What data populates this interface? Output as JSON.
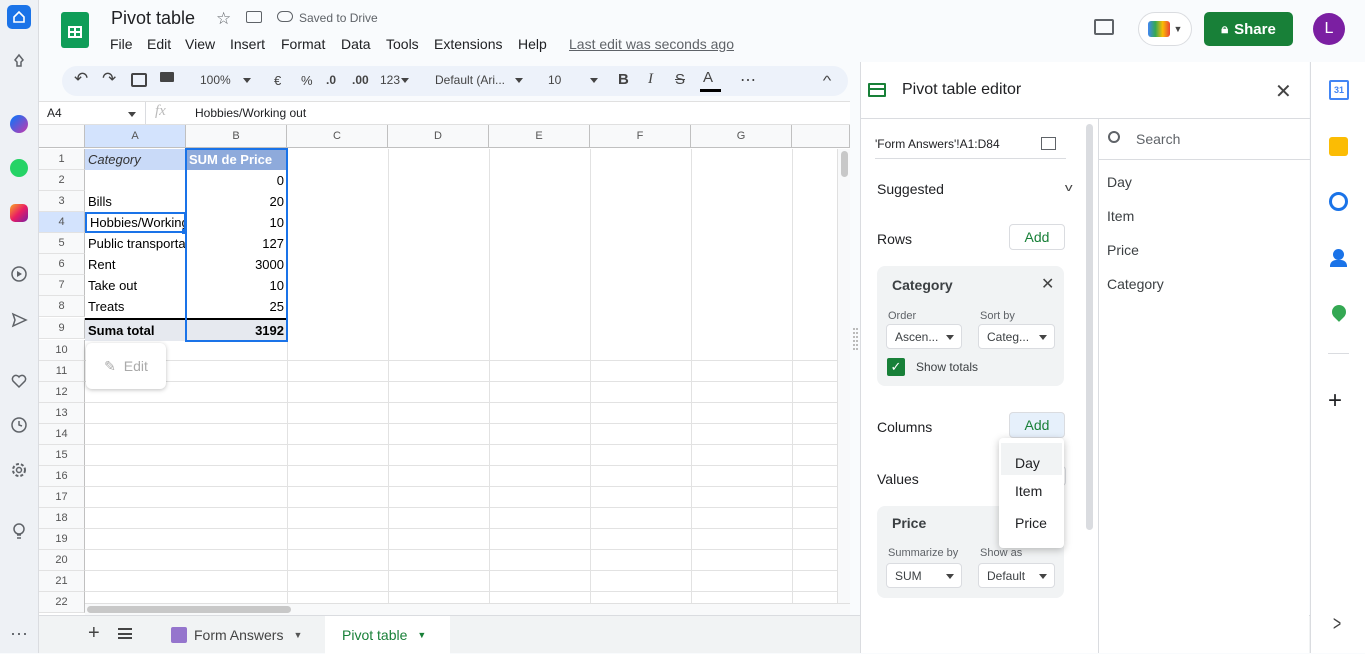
{
  "doc": {
    "title": "Pivot table",
    "saved_status": "Saved to Drive",
    "last_edit": "Last edit was seconds ago"
  },
  "menu": [
    "File",
    "Edit",
    "View",
    "Insert",
    "Format",
    "Data",
    "Tools",
    "Extensions",
    "Help"
  ],
  "share_label": "Share",
  "avatar_letter": "L",
  "toolbar": {
    "zoom": "100%",
    "currency": "€",
    "percent": "%",
    "dec_less": ".0",
    "dec_more": ".00",
    "format_num": "123",
    "font": "Default (Ari...",
    "font_size": "10",
    "bold": "B",
    "italic": "I",
    "strike": "S",
    "textcolor": "A",
    "more": "⋯"
  },
  "formula_bar": {
    "cell_ref": "A4",
    "fx": "fx",
    "value": "Hobbies/Working out"
  },
  "columns": [
    "A",
    "B",
    "C",
    "D",
    "E",
    "F",
    "G"
  ],
  "rows": [
    "1",
    "2",
    "3",
    "4",
    "5",
    "6",
    "7",
    "8",
    "9",
    "10",
    "11",
    "12",
    "13",
    "14",
    "15",
    "16",
    "17",
    "18",
    "19",
    "20",
    "21",
    "22"
  ],
  "pivot": {
    "header_a": "Category",
    "header_b": "SUM de Price",
    "row_labels": [
      "",
      "Bills",
      "Hobbies/Working out",
      "Public transportation",
      "Rent",
      "Take out",
      "Treats"
    ],
    "row_values": [
      "0",
      "20",
      "10",
      "127",
      "3000",
      "10",
      "25"
    ],
    "total_label": "Suma total",
    "total_value": "3192"
  },
  "edit_chip": "Edit",
  "sheets": [
    {
      "name": "Form Answers"
    },
    {
      "name": "Pivot table"
    }
  ],
  "editor": {
    "title": "Pivot table editor",
    "range": "'Form Answers'!A1:D84",
    "suggested": "Suggested",
    "rows_label": "Rows",
    "columns_label": "Columns",
    "values_label": "Values",
    "add": "Add",
    "rows_card": {
      "title": "Category",
      "order_label": "Order",
      "order_value": "Ascen...",
      "sortby_label": "Sort by",
      "sortby_value": "Categ...",
      "show_totals": "Show totals"
    },
    "values_card": {
      "title": "Price",
      "summarize_label": "Summarize by",
      "summarize_value": "SUM",
      "showas_label": "Show as",
      "showas_value": "Default"
    },
    "search_placeholder": "Search",
    "fields": [
      "Day",
      "Item",
      "Price",
      "Category"
    ],
    "dropdown": [
      "Day",
      "Item",
      "Price"
    ]
  },
  "colors": {
    "accent": "#188038",
    "selection": "#1a73e8",
    "pivot_header": "#c9daf8"
  }
}
